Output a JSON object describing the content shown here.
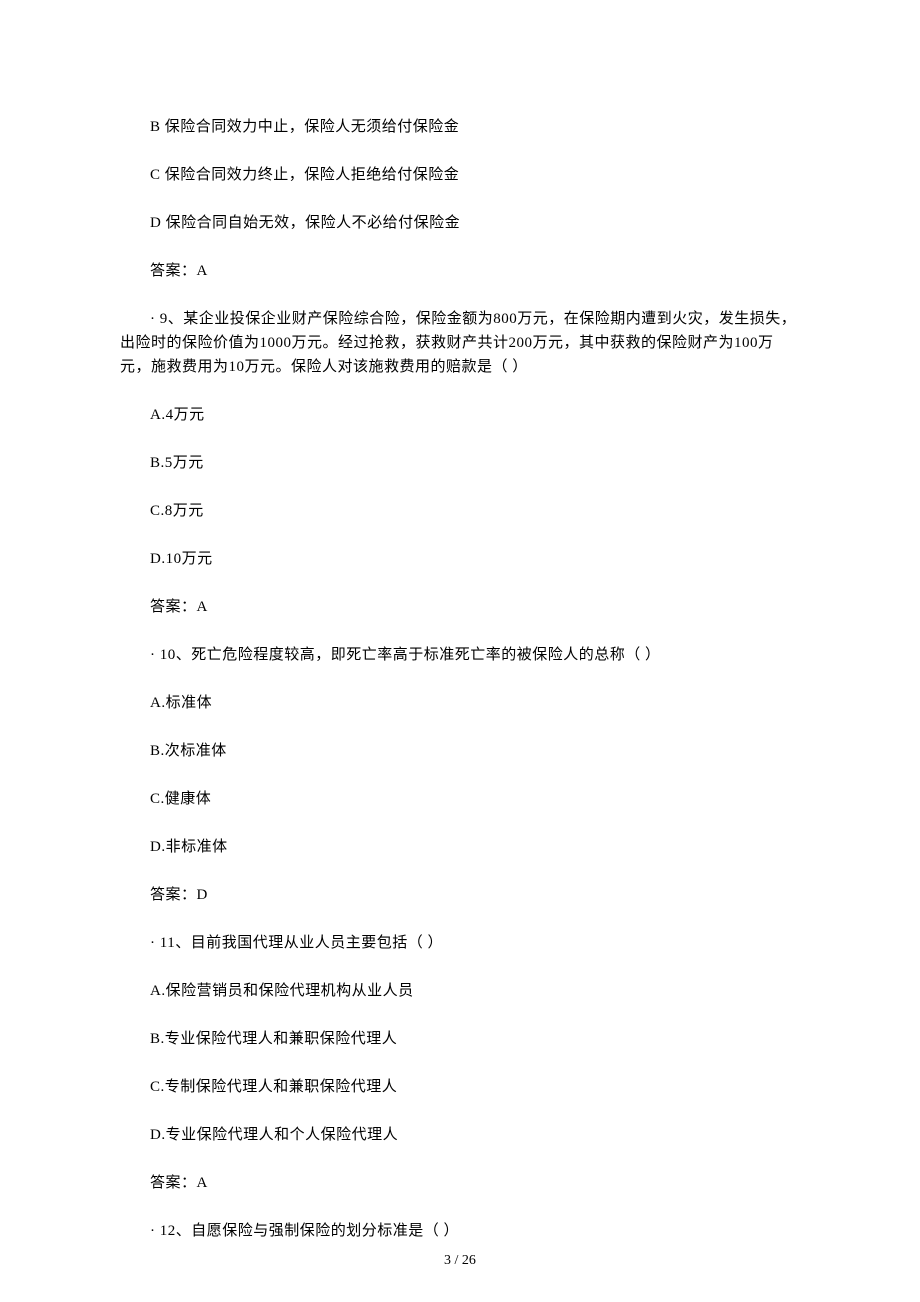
{
  "q8": {
    "optB": "B 保险合同效力中止，保险人无须给付保险金",
    "optC": "C 保险合同效力终止，保险人拒绝给付保险金",
    "optD": "D 保险合同自始无效，保险人不必给付保险金",
    "answer": "答案：A"
  },
  "q9": {
    "stem": "· 9、某企业投保企业财产保险综合险，保险金额为800万元，在保险期内遭到火灾，发生损失，出险时的保险价值为1000万元。经过抢救，获救财产共计200万元，其中获救的保险财产为100万元，施救费用为10万元。保险人对该施救费用的赔款是（ ）",
    "optA": "A.4万元",
    "optB": "B.5万元",
    "optC": "C.8万元",
    "optD": "D.10万元",
    "answer": "答案：A"
  },
  "q10": {
    "stem": "·  10、死亡危险程度较高，即死亡率高于标准死亡率的被保险人的总称（ ）",
    "optA": "A.标准体",
    "optB": "B.次标准体",
    "optC": "C.健康体",
    "optD": "D.非标准体",
    "answer": "答案：D"
  },
  "q11": {
    "stem": "·  11、目前我国代理从业人员主要包括（ ）",
    "optA": "A.保险营销员和保险代理机构从业人员",
    "optB": "B.专业保险代理人和兼职保险代理人",
    "optC": "C.专制保险代理人和兼职保险代理人",
    "optD": "D.专业保险代理人和个人保险代理人",
    "answer": "答案：A"
  },
  "q12": {
    "stem": "·  12、自愿保险与强制保险的划分标准是（ ）"
  },
  "footer": "3  / 26"
}
